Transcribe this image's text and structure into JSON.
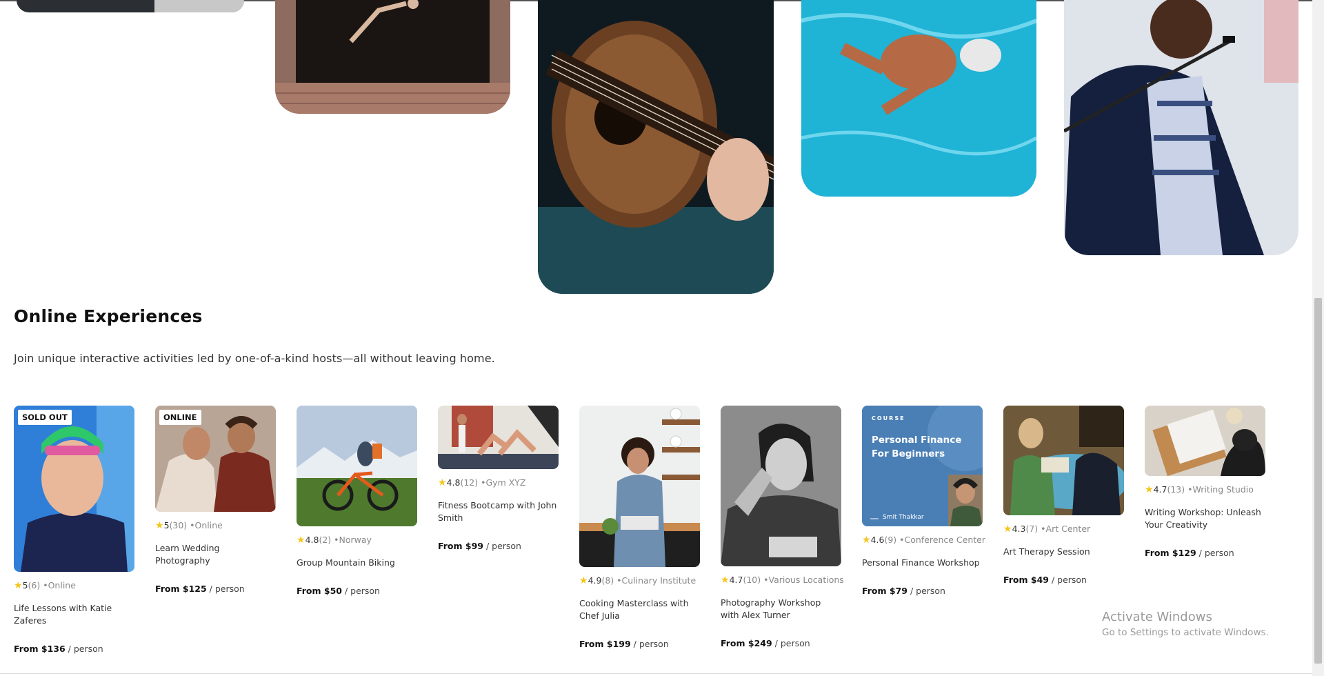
{
  "section": {
    "title": "Online Experiences",
    "subtitle": "Join unique interactive activities led by one-of-a-kind hosts—all without leaving home."
  },
  "gallery": [
    {
      "id": "g1",
      "depicts": "dark-image"
    },
    {
      "id": "g2",
      "depicts": "dancer-leaping"
    },
    {
      "id": "g3",
      "depicts": "acoustic-guitar"
    },
    {
      "id": "g4",
      "depicts": "swimmer-in-pool"
    },
    {
      "id": "g5",
      "depicts": "singer-with-microphone"
    }
  ],
  "cards": [
    {
      "badge": "SOLD OUT",
      "rating": "5",
      "reviews": "(6)",
      "location": "•Online",
      "title": "Life Lessons with Katie Zaferes",
      "price": "From $136",
      "unit": "/ person"
    },
    {
      "badge": "ONLINE",
      "rating": "5",
      "reviews": "(30)",
      "location": "•Online",
      "title": "Learn Wedding Photography",
      "price": "From $125",
      "unit": "/ person"
    },
    {
      "rating": "4.8",
      "reviews": "(2)",
      "location": "•Norway",
      "title": "Group Mountain Biking",
      "price": "From $50",
      "unit": "/ person"
    },
    {
      "rating": "4.8",
      "reviews": "(12)",
      "location": "•Gym XYZ",
      "title": "Fitness Bootcamp with John Smith",
      "price": "From $99",
      "unit": "/ person"
    },
    {
      "rating": "4.9",
      "reviews": "(8)",
      "location": "•Culinary Institute",
      "title": "Cooking Masterclass with Chef Julia",
      "price": "From $199",
      "unit": "/ person"
    },
    {
      "rating": "4.7",
      "reviews": "(10)",
      "location": "•Various Locations",
      "title": "Photography Workshop with Alex Turner",
      "price": "From $249",
      "unit": "/ person"
    },
    {
      "rating": "4.6",
      "reviews": "(9)",
      "location": "•Conference Center",
      "title": "Personal Finance Workshop",
      "price": "From $79",
      "unit": "/ person",
      "image_text": {
        "kicker": "COURSE",
        "line1": "Personal Finance",
        "line2": "For Beginners",
        "author": "Smit Thakkar"
      }
    },
    {
      "rating": "4.3",
      "reviews": "(7)",
      "location": "•Art Center",
      "title": "Art Therapy Session",
      "price": "From $49",
      "unit": "/ person"
    },
    {
      "rating": "4.7",
      "reviews": "(13)",
      "location": "•Writing Studio",
      "title": "Writing Workshop: Unleash Your Creativity",
      "price": "From $129",
      "unit": "/ person"
    }
  ],
  "windows_notice": {
    "line1": "Activate Windows",
    "line2": "Go to Settings to activate Windows."
  },
  "colors": {
    "star": "#f5c518",
    "finance_card": "#4a7fb5",
    "pool": "#1fb3d6"
  }
}
